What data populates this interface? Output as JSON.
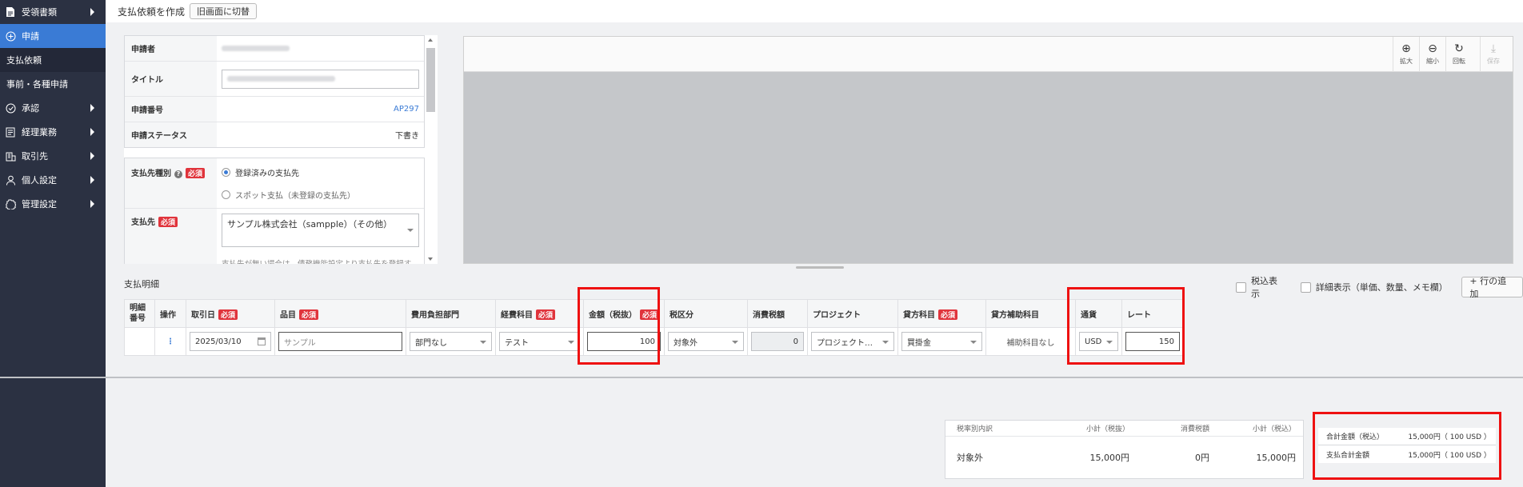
{
  "sidebar": {
    "items": [
      {
        "label": "受領書類",
        "icon": "document-icon"
      },
      {
        "label": "申請",
        "icon": "plus-circle-icon"
      },
      {
        "label": "支払依頼"
      },
      {
        "label": "事前・各種申請"
      },
      {
        "label": "承認",
        "icon": "check-circle-icon"
      },
      {
        "label": "経理業務",
        "icon": "ledger-icon"
      },
      {
        "label": "取引先",
        "icon": "building-icon"
      },
      {
        "label": "個人設定",
        "icon": "person-icon"
      },
      {
        "label": "管理設定",
        "icon": "gear-icon"
      }
    ]
  },
  "header": {
    "title": "支払依頼を作成",
    "switch_button": "旧画面に切替"
  },
  "form": {
    "applicant_label": "申請者",
    "title_label": "タイトル",
    "number_label": "申請番号",
    "number_value": "AP297",
    "status_label": "申請ステータス",
    "status_value": "下書き",
    "payee_type_label": "支払先種別",
    "required": "必須",
    "payee_type_options": [
      "登録済みの支払先",
      "スポット支払（未登録の支払先）"
    ],
    "payee_label": "支払先",
    "payee_value": "サンプル株式会社（sampple）（その他）",
    "payee_hint": "支払先が無い場合は、債務機能設定より支払先を登録す"
  },
  "preview": {
    "tools": [
      {
        "label": "拡大",
        "glyph": "⊕"
      },
      {
        "label": "縮小",
        "glyph": "⊖"
      },
      {
        "label": "回転",
        "glyph": "↻"
      },
      {
        "label": "保存",
        "glyph": "⤓"
      }
    ]
  },
  "lines": {
    "title": "支払明細",
    "tax_display": "税込表示",
    "detail_display": "詳細表示（単価、数量、メモ欄）",
    "add_row": "+ 行の追加",
    "headers": {
      "no": "明細番号",
      "op": "操作",
      "date": "取引日",
      "item": "品目",
      "dept": "費用負担部門",
      "account": "経費科目",
      "amount": "金額（税抜）",
      "tax_type": "税区分",
      "tax": "消費税額",
      "project": "プロジェクト",
      "credit": "貸方科目",
      "credit_sub": "貸方補助科目",
      "currency": "通貨",
      "rate": "レート"
    },
    "row": {
      "date": "2025/03/10",
      "item": "サンプル",
      "dept": "部門なし",
      "account": "テスト",
      "amount": "100",
      "tax_type": "対象外",
      "tax": "0",
      "project": "プロジェクト…",
      "credit": "買掛金",
      "credit_sub": "補助科目なし",
      "currency": "USD",
      "rate": "150"
    }
  },
  "summary": {
    "headers": [
      "税率別内訳",
      "小計（税抜）",
      "消費税額",
      "小計（税込）"
    ],
    "row": [
      "対象外",
      "15,000円",
      "0円",
      "15,000円"
    ]
  },
  "totals": [
    {
      "label": "合計金額（税込）",
      "value": "15,000円",
      "usd": "（ 100 USD ）"
    },
    {
      "label": "支払合計金額",
      "value": "15,000円",
      "usd": "（ 100 USD ）"
    }
  ],
  "colors": {
    "accent": "#3a7bd5",
    "highlight": "#ee1111",
    "required": "#e0343c",
    "sidebar": "#2b3142"
  }
}
